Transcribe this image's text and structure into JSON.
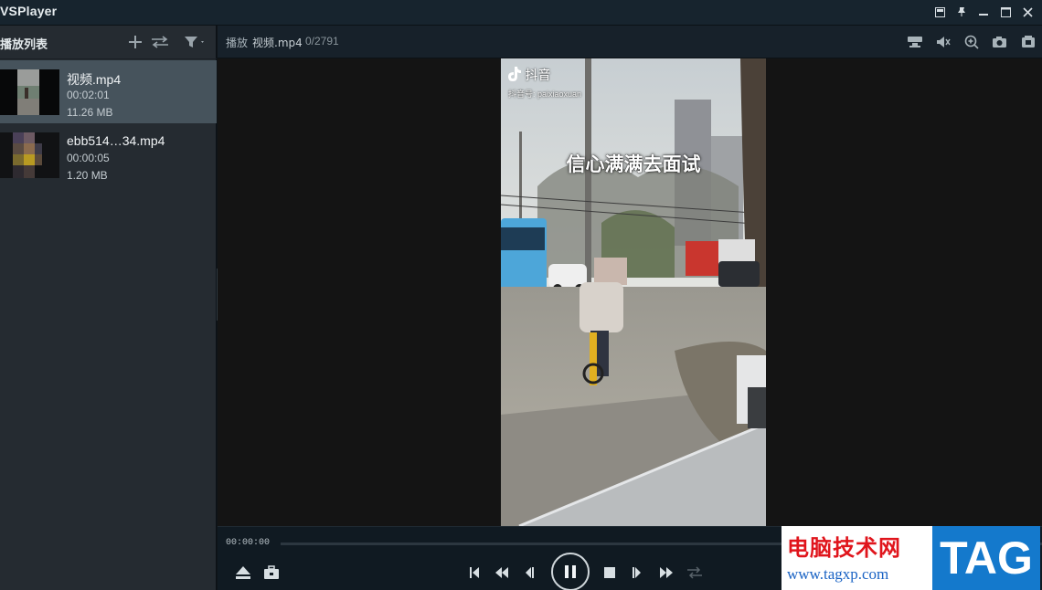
{
  "app": {
    "title": "VSPlayer"
  },
  "window_controls": [
    "restore-icon",
    "pin-icon",
    "minimize-icon",
    "maximize-icon",
    "close-icon"
  ],
  "sidebar": {
    "title": "播放列表",
    "items": [
      {
        "name": "视频.mp4",
        "duration": "00:02:01",
        "size": "11.26 MB",
        "selected": true
      },
      {
        "name": "ebb514…34.mp4",
        "duration": "00:00:05",
        "size": "1.20 MB",
        "selected": false
      }
    ]
  },
  "header": {
    "label": "播放",
    "file": "视频.mp4",
    "frame_count": "0/2791",
    "icons": [
      "camera-icon",
      "audio-icon",
      "zoom-icon",
      "snapshot-icon",
      "record-icon"
    ]
  },
  "video": {
    "tiktok_brand": "抖音",
    "tiktok_id": "抖音号: paixiaoxuan",
    "caption": "信心满满去面试"
  },
  "controls": {
    "current_time": "00:00:00",
    "progress": 0.0
  },
  "watermark": {
    "cn": "电脑技术网",
    "url": "www.tagxp.com",
    "tag": "TAG"
  },
  "colors": {
    "titlebar": "#17242e",
    "sidebar": "#252b31",
    "selected_item": "#46535c",
    "video_bg": "#141414",
    "watermark_red": "#e0151c",
    "watermark_blue": "#1479cc"
  }
}
